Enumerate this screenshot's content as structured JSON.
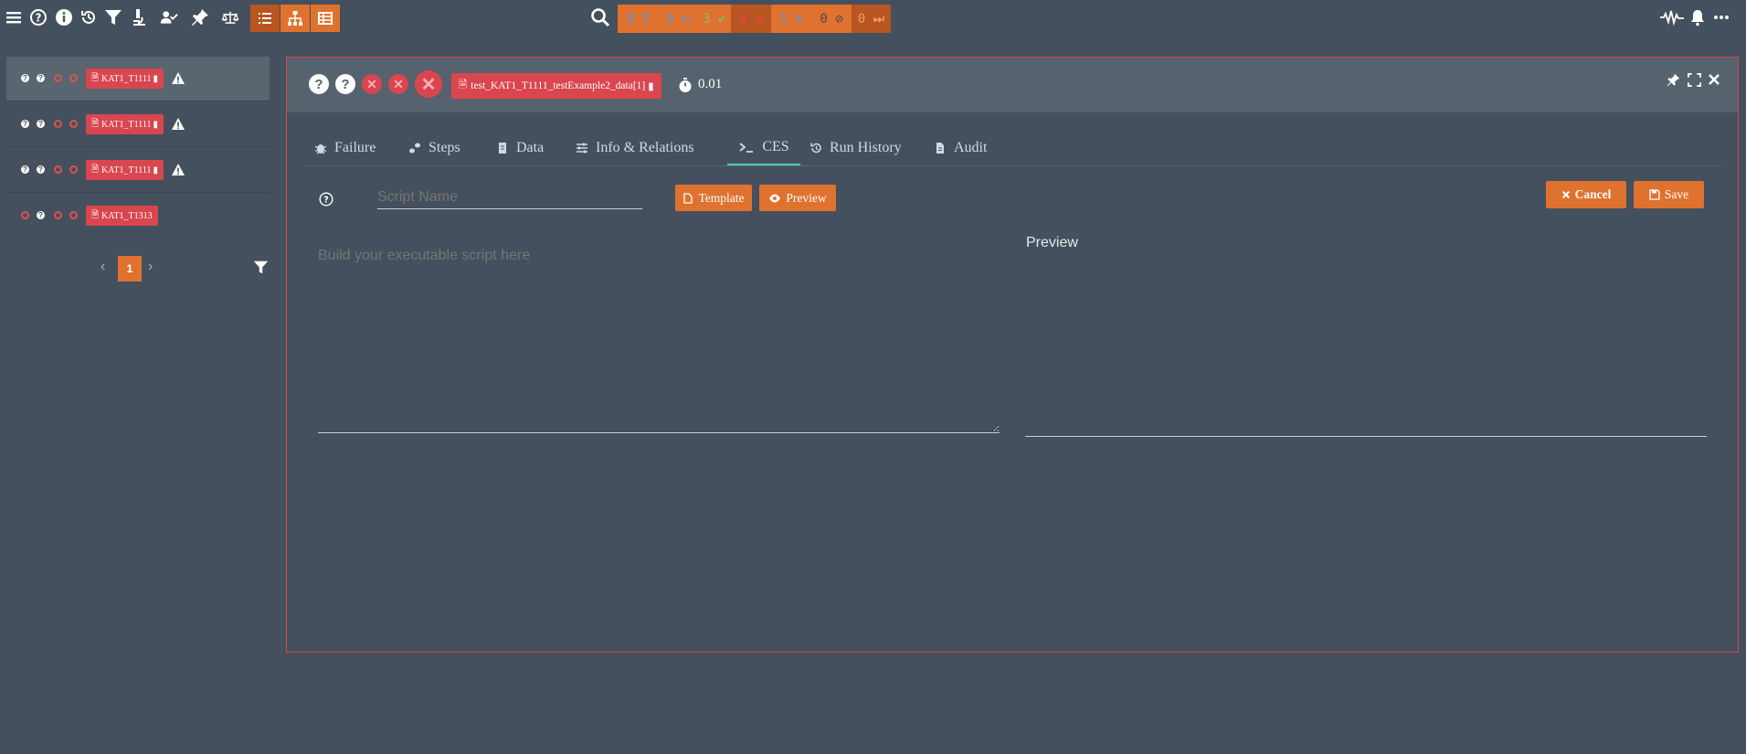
{
  "toolbar": {
    "icons": [
      "menu-icon",
      "help-icon",
      "info-icon",
      "history-icon",
      "filter-icon",
      "microscope-icon",
      "user-check-icon",
      "pin-icon",
      "balance-icon"
    ],
    "views": [
      "list-view-icon",
      "tree-view-icon",
      "table-view-icon"
    ],
    "stats": [
      {
        "value": "8",
        "icon": "sigma",
        "color": "#5a8fd8",
        "bg": "#e0722f"
      },
      {
        "value": "0",
        "icon": "redo",
        "color": "#5a8fd8",
        "bg": "#e0722f"
      },
      {
        "value": "3",
        "icon": "check",
        "color": "#7cc06a",
        "bg": "#e0722f"
      },
      {
        "value": "4",
        "icon": "x-circle",
        "color": "#e04848",
        "bg": "#b85520"
      },
      {
        "value": "1",
        "icon": "broken-bulb",
        "color": "#5a8fd8",
        "bg": "#e0722f"
      },
      {
        "value": "0",
        "icon": "ban",
        "color": "#555",
        "bg": "#e0722f"
      },
      {
        "value": "0",
        "icon": "fast-forward",
        "color": "#f0a060",
        "bg": "#b85520"
      }
    ],
    "right_icons": [
      "waveform-icon",
      "bell-icon",
      "more-icon"
    ]
  },
  "sidebar": {
    "items": [
      {
        "label": "KAT1_T1111",
        "warning": true,
        "selected": true
      },
      {
        "label": "KAT1_T1111",
        "warning": true,
        "selected": false
      },
      {
        "label": "KAT1_T1111",
        "warning": true,
        "selected": false
      },
      {
        "label": "KAT1_T1313",
        "warning": false,
        "selected": false
      }
    ],
    "page": "1"
  },
  "panel": {
    "test_name": "test_KAT1_T1111_testExample2_data[1]",
    "duration": "0.01",
    "tabs": [
      {
        "label": "Failure",
        "icon": "bug-icon"
      },
      {
        "label": "Steps",
        "icon": "steps-icon"
      },
      {
        "label": "Data",
        "icon": "data-icon"
      },
      {
        "label": "Info & Relations",
        "icon": "sliders-icon"
      },
      {
        "label": "CES",
        "icon": "terminal-icon",
        "active": true
      },
      {
        "label": "Run History",
        "icon": "history-icon"
      },
      {
        "label": "Audit",
        "icon": "file-icon"
      }
    ],
    "script_name_placeholder": "Script Name",
    "template_label": "Template",
    "preview_button_label": "Preview",
    "cancel_label": "Cancel",
    "save_label": "Save",
    "script_placeholder": "Build your executable script here",
    "preview_heading": "Preview"
  },
  "colors": {
    "accent": "#e0722f",
    "danger": "#d9464f",
    "bg": "#44505d",
    "active_tab": "#4fd1a5"
  }
}
